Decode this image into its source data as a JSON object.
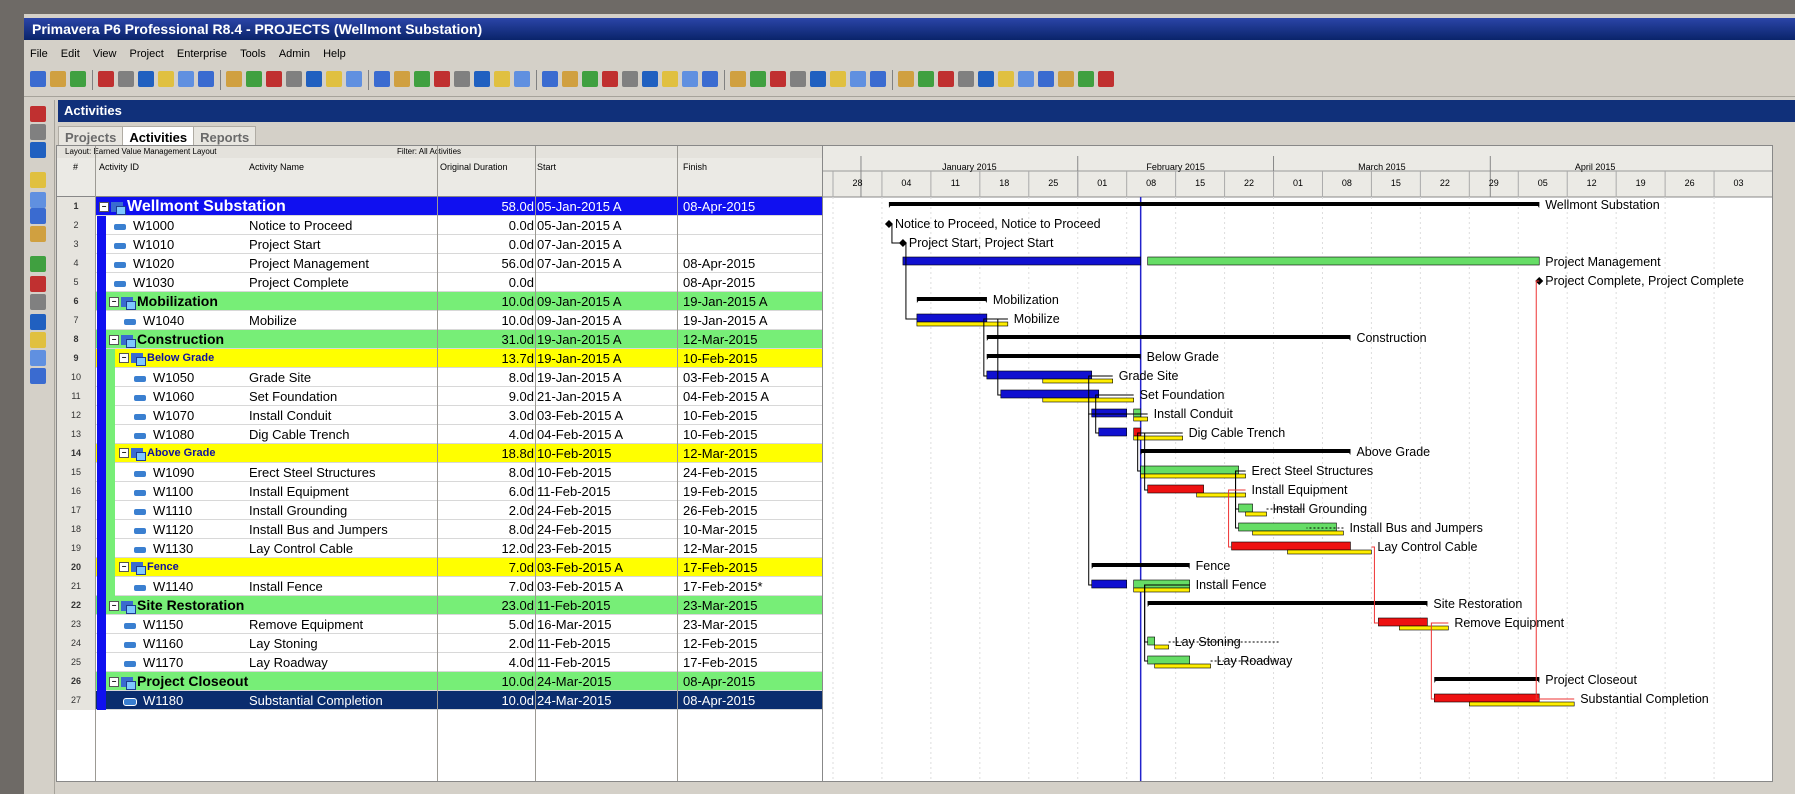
{
  "window": {
    "title": "Primavera P6 Professional R8.4 - PROJECTS (Wellmont Substation)"
  },
  "menu": [
    "File",
    "Edit",
    "View",
    "Project",
    "Enterprise",
    "Tools",
    "Admin",
    "Help"
  ],
  "header": {
    "title": "Activities"
  },
  "tabs": [
    {
      "label": "Projects",
      "active": false
    },
    {
      "label": "Activities",
      "active": true
    },
    {
      "label": "Reports",
      "active": false
    }
  ],
  "grid": {
    "layout_label": "Layout: Earned Value Management Layout",
    "filter_label": "Filter: All Activities",
    "columns": {
      "num": "#",
      "id": "Activity ID",
      "name": "Activity Name",
      "duration": "Original Duration",
      "start": "Start",
      "finish": "Finish"
    }
  },
  "timescale": {
    "months": [
      "January 2015",
      "February 2015",
      "March 2015",
      "April 2015"
    ],
    "days": [
      "28",
      "04",
      "11",
      "18",
      "25",
      "01",
      "08",
      "15",
      "22",
      "01",
      "08",
      "15",
      "22",
      "29",
      "05",
      "12",
      "19",
      "26",
      "03"
    ]
  },
  "rows": [
    {
      "num": "1",
      "level": 0,
      "id": "Wellmont Substation",
      "name": "",
      "dur": "58.0d",
      "start": "05-Jan-2015 A",
      "finish": "08-Apr-2015",
      "gantt_label": "Wellmont Substation"
    },
    {
      "num": "2",
      "level": 3,
      "id": "W1000",
      "name": "Notice to Proceed",
      "dur": "0.0d",
      "start": "05-Jan-2015 A",
      "finish": "",
      "gantt_label": "Notice to Proceed, Notice to Proceed"
    },
    {
      "num": "3",
      "level": 3,
      "id": "W1010",
      "name": "Project Start",
      "dur": "0.0d",
      "start": "07-Jan-2015 A",
      "finish": "",
      "gantt_label": "Project Start, Project Start"
    },
    {
      "num": "4",
      "level": 3,
      "id": "W1020",
      "name": "Project Management",
      "dur": "56.0d",
      "start": "07-Jan-2015 A",
      "finish": "08-Apr-2015",
      "gantt_label": "Project Management"
    },
    {
      "num": "5",
      "level": 3,
      "id": "W1030",
      "name": "Project Complete",
      "dur": "0.0d",
      "start": "",
      "finish": "08-Apr-2015",
      "gantt_label": "Project Complete, Project Complete"
    },
    {
      "num": "6",
      "level": 1,
      "id": "Mobilization",
      "name": "",
      "dur": "10.0d",
      "start": "09-Jan-2015 A",
      "finish": "19-Jan-2015 A",
      "gantt_label": "Mobilization"
    },
    {
      "num": "7",
      "level": 4,
      "id": "W1040",
      "name": "Mobilize",
      "dur": "10.0d",
      "start": "09-Jan-2015 A",
      "finish": "19-Jan-2015 A",
      "gantt_label": "Mobilize"
    },
    {
      "num": "8",
      "level": 1,
      "id": "Construction",
      "name": "",
      "dur": "31.0d",
      "start": "19-Jan-2015 A",
      "finish": "12-Mar-2015",
      "gantt_label": "Construction"
    },
    {
      "num": "9",
      "level": 2,
      "id": "Below Grade",
      "name": "",
      "dur": "13.7d",
      "start": "19-Jan-2015 A",
      "finish": "10-Feb-2015",
      "gantt_label": "Below Grade"
    },
    {
      "num": "10",
      "level": 5,
      "id": "W1050",
      "name": "Grade Site",
      "dur": "8.0d",
      "start": "19-Jan-2015 A",
      "finish": "03-Feb-2015 A",
      "gantt_label": "Grade Site"
    },
    {
      "num": "11",
      "level": 5,
      "id": "W1060",
      "name": "Set Foundation",
      "dur": "9.0d",
      "start": "21-Jan-2015 A",
      "finish": "04-Feb-2015 A",
      "gantt_label": "Set Foundation"
    },
    {
      "num": "12",
      "level": 5,
      "id": "W1070",
      "name": "Install Conduit",
      "dur": "3.0d",
      "start": "03-Feb-2015 A",
      "finish": "10-Feb-2015",
      "gantt_label": "Install Conduit"
    },
    {
      "num": "13",
      "level": 5,
      "id": "W1080",
      "name": "Dig Cable Trench",
      "dur": "4.0d",
      "start": "04-Feb-2015 A",
      "finish": "10-Feb-2015",
      "gantt_label": "Dig Cable Trench"
    },
    {
      "num": "14",
      "level": 2,
      "id": "Above Grade",
      "name": "",
      "dur": "18.8d",
      "start": "10-Feb-2015",
      "finish": "12-Mar-2015",
      "gantt_label": "Above Grade"
    },
    {
      "num": "15",
      "level": 5,
      "id": "W1090",
      "name": "Erect Steel Structures",
      "dur": "8.0d",
      "start": "10-Feb-2015",
      "finish": "24-Feb-2015",
      "gantt_label": "Erect Steel Structures"
    },
    {
      "num": "16",
      "level": 5,
      "id": "W1100",
      "name": "Install Equipment",
      "dur": "6.0d",
      "start": "11-Feb-2015",
      "finish": "19-Feb-2015",
      "gantt_label": "Install Equipment"
    },
    {
      "num": "17",
      "level": 5,
      "id": "W1110",
      "name": "Install Grounding",
      "dur": "2.0d",
      "start": "24-Feb-2015",
      "finish": "26-Feb-2015",
      "gantt_label": "Install Grounding"
    },
    {
      "num": "18",
      "level": 5,
      "id": "W1120",
      "name": "Install Bus and Jumpers",
      "dur": "8.0d",
      "start": "24-Feb-2015",
      "finish": "10-Mar-2015",
      "gantt_label": "Install Bus and Jumpers"
    },
    {
      "num": "19",
      "level": 5,
      "id": "W1130",
      "name": "Lay Control Cable",
      "dur": "12.0d",
      "start": "23-Feb-2015",
      "finish": "12-Mar-2015",
      "gantt_label": "Lay Control Cable"
    },
    {
      "num": "20",
      "level": 2,
      "id": "Fence",
      "name": "",
      "dur": "7.0d",
      "start": "03-Feb-2015 A",
      "finish": "17-Feb-2015",
      "gantt_label": "Fence"
    },
    {
      "num": "21",
      "level": 5,
      "id": "W1140",
      "name": "Install Fence",
      "dur": "7.0d",
      "start": "03-Feb-2015 A",
      "finish": "17-Feb-2015*",
      "gantt_label": "Install Fence"
    },
    {
      "num": "22",
      "level": 1,
      "id": "Site Restoration",
      "name": "",
      "dur": "23.0d",
      "start": "11-Feb-2015",
      "finish": "23-Mar-2015",
      "gantt_label": "Site Restoration"
    },
    {
      "num": "23",
      "level": 4,
      "id": "W1150",
      "name": "Remove Equipment",
      "dur": "5.0d",
      "start": "16-Mar-2015",
      "finish": "23-Mar-2015",
      "gantt_label": "Remove Equipment"
    },
    {
      "num": "24",
      "level": 4,
      "id": "W1160",
      "name": "Lay Stoning",
      "dur": "2.0d",
      "start": "11-Feb-2015",
      "finish": "12-Feb-2015",
      "gantt_label": "Lay Stoning"
    },
    {
      "num": "25",
      "level": 4,
      "id": "W1170",
      "name": "Lay Roadway",
      "dur": "4.0d",
      "start": "11-Feb-2015",
      "finish": "17-Feb-2015",
      "gantt_label": "Lay Roadway"
    },
    {
      "num": "26",
      "level": 1,
      "id": "Project Closeout",
      "name": "",
      "dur": "10.0d",
      "start": "24-Mar-2015",
      "finish": "08-Apr-2015",
      "gantt_label": "Project Closeout"
    },
    {
      "num": "27",
      "level": 4,
      "id": "W1180",
      "name": "Substantial Completion",
      "dur": "10.0d",
      "start": "24-Mar-2015",
      "finish": "08-Apr-2015",
      "gantt_label": "Substantial Completion",
      "selected": true
    }
  ],
  "colors": {
    "level0": "#1010f0",
    "level1": "#77ee77",
    "level2": "#ffff00",
    "actual": "#1010d0",
    "critical": "#ee1111",
    "remaining": "#66dd66",
    "baseline": "#ffee00",
    "summary": "#000000",
    "data_date": "#2222cc"
  }
}
